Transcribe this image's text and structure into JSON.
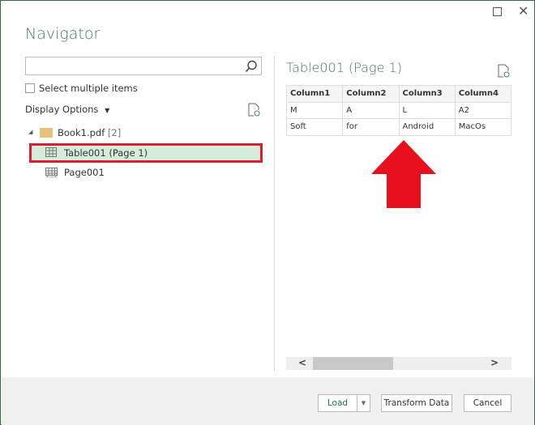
{
  "window": {
    "title": "Navigator"
  },
  "search": {
    "placeholder": "",
    "value": ""
  },
  "select_multiple": {
    "label": "Select multiple items",
    "checked": false
  },
  "display_options": {
    "label": "Display Options"
  },
  "tree": {
    "root": {
      "label": "Book1.pdf",
      "count": "[2]",
      "icon": "folder-icon"
    },
    "items": [
      {
        "label": "Table001 (Page 1)",
        "icon": "table-icon",
        "selected": true
      },
      {
        "label": "Page001",
        "icon": "page-icon",
        "selected": false
      }
    ]
  },
  "preview": {
    "title": "Table001 (Page 1)",
    "columns": [
      "Column1",
      "Column2",
      "Column3",
      "Column4"
    ],
    "rows": [
      [
        "M",
        "A",
        "L",
        "A2"
      ],
      [
        "Soft",
        "for",
        "Android",
        "MacOs"
      ]
    ]
  },
  "buttons": {
    "load": "Load",
    "transform": "Transform Data",
    "cancel": "Cancel"
  },
  "colors": {
    "accent": "#217346",
    "highlight": "#d9202b",
    "selected_bg": "#d5ecdd"
  }
}
